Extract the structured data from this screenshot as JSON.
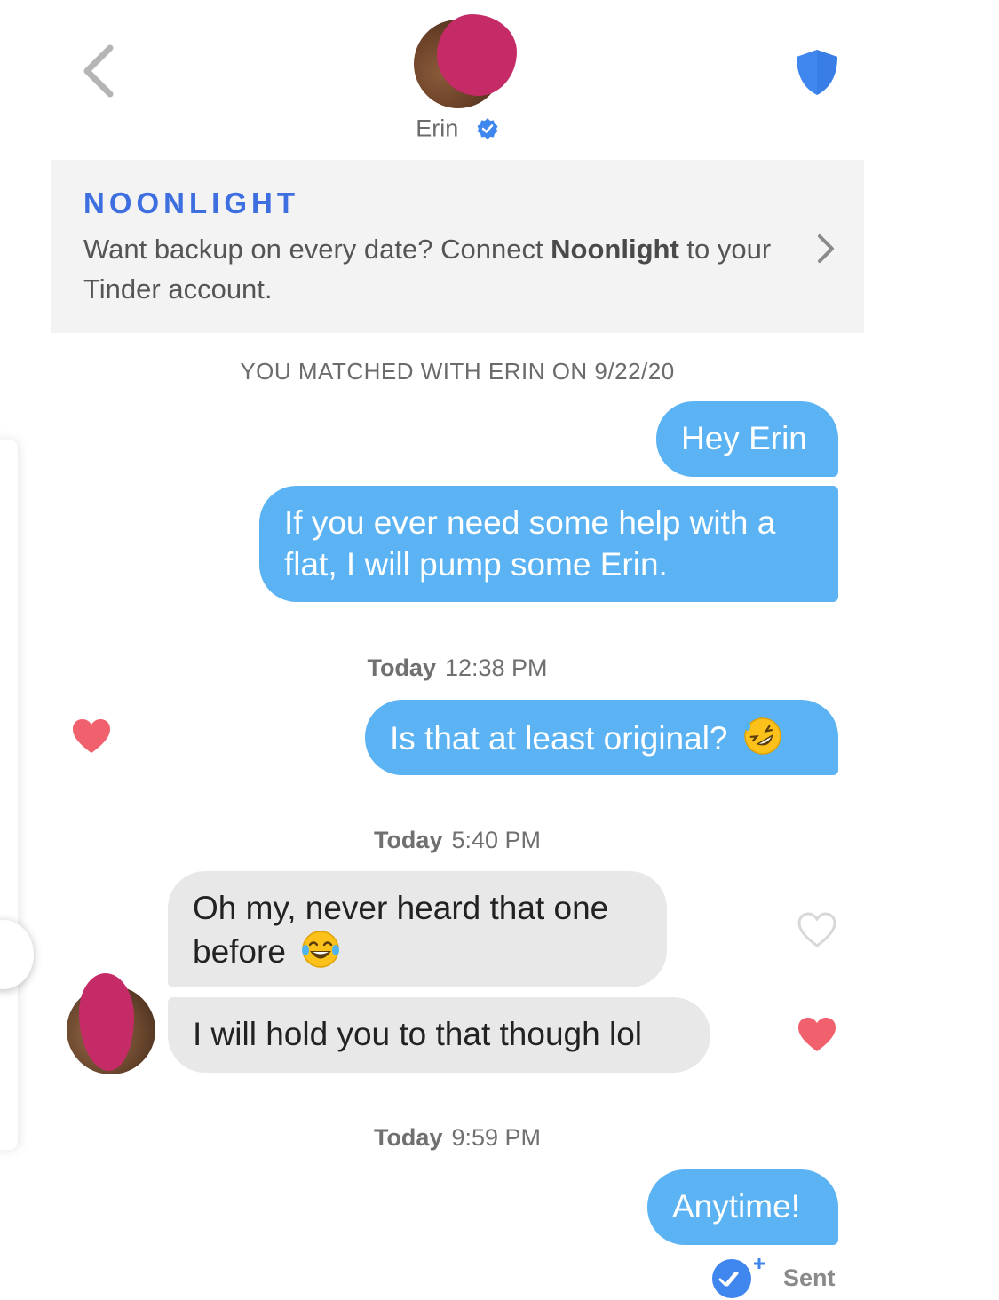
{
  "header": {
    "match_name": "Erin",
    "icons": {
      "back": "chevron-left-icon",
      "safety": "shield-icon",
      "verified": "verified-badge-icon"
    }
  },
  "banner": {
    "logo": "NOONLIGHT",
    "text_before": "Want backup on every date? Connect ",
    "text_bold": "Noonlight",
    "text_after": " to your Tinder account."
  },
  "matched_text": "YOU MATCHED WITH ERIN ON 9/22/20",
  "messages": [
    {
      "direction": "out",
      "text": "Hey Erin"
    },
    {
      "direction": "out",
      "text": "If you ever need some help with a flat, I will pump some Erin."
    },
    {
      "direction": "out",
      "text": "Is that at least original?",
      "emoji": "rolling-on-floor-laughing",
      "liked": true
    },
    {
      "direction": "in",
      "text": "Oh my, never heard that one before",
      "emoji": "face-with-tears-of-joy",
      "liked": false
    },
    {
      "direction": "in",
      "text": "I will hold you to that though lol",
      "liked": true
    },
    {
      "direction": "out",
      "text": "Anytime!"
    }
  ],
  "timestamps": [
    {
      "day": "Today",
      "time": "12:38 PM"
    },
    {
      "day": "Today",
      "time": "5:40 PM"
    },
    {
      "day": "Today",
      "time": "9:59 PM"
    }
  ],
  "status": {
    "label": "Sent"
  },
  "colors": {
    "outgoing_bubble": "#5bb3f4",
    "incoming_bubble": "#e8e8e8",
    "banner_bg": "#f3f3f3",
    "brand_blue": "#3d6fe0",
    "heart": "#f0616d",
    "redaction": "#c42b67"
  }
}
